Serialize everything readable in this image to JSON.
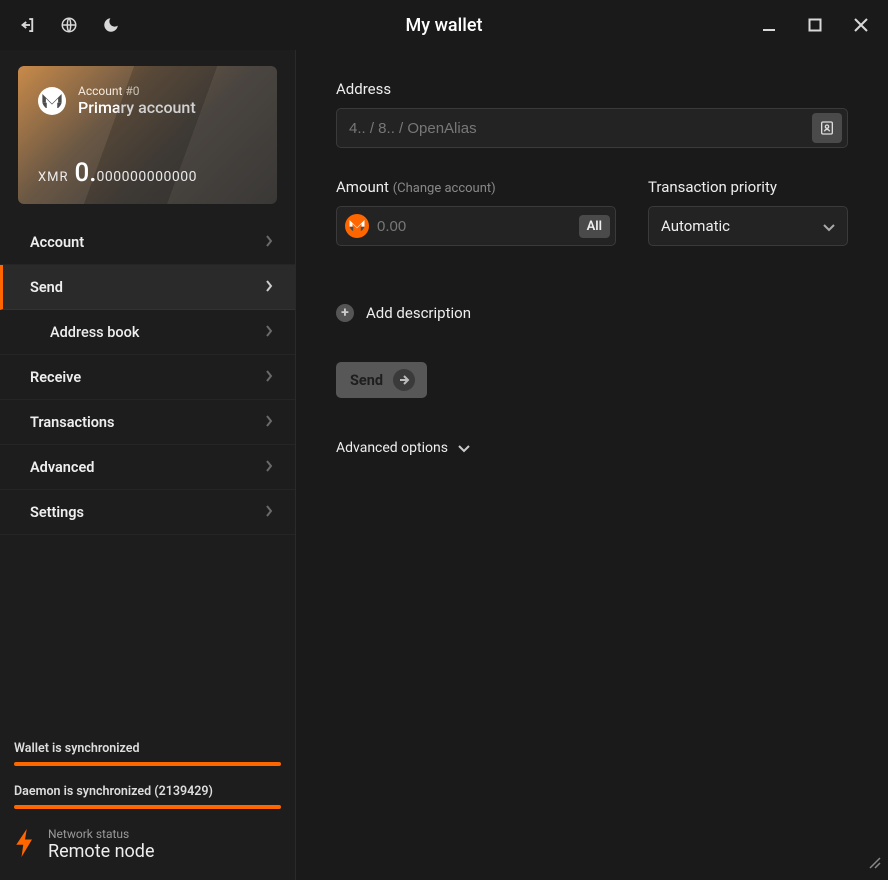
{
  "titlebar": {
    "title": "My wallet"
  },
  "account_card": {
    "account_number_label": "Account #0",
    "account_name": "Primary account",
    "currency": "XMR",
    "balance_int": "0.",
    "balance_dec": "000000000000"
  },
  "nav": {
    "items": [
      {
        "label": "Account"
      },
      {
        "label": "Send"
      },
      {
        "label": "Address book"
      },
      {
        "label": "Receive"
      },
      {
        "label": "Transactions"
      },
      {
        "label": "Advanced"
      },
      {
        "label": "Settings"
      }
    ]
  },
  "sidebar_footer": {
    "wallet_sync": "Wallet is synchronized",
    "daemon_sync": "Daemon is synchronized (2139429)",
    "network_label": "Network status",
    "network_value": "Remote node"
  },
  "send_form": {
    "address_label": "Address",
    "address_placeholder": "4.. / 8.. / OpenAlias",
    "amount_label": "Amount",
    "amount_changeaccount": "(Change account)",
    "amount_placeholder": "0.00",
    "all_button": "All",
    "priority_label": "Transaction priority",
    "priority_value": "Automatic",
    "add_description": "Add description",
    "send_button": "Send",
    "advanced_options": "Advanced options"
  },
  "colors": {
    "accent": "#ff6600"
  }
}
